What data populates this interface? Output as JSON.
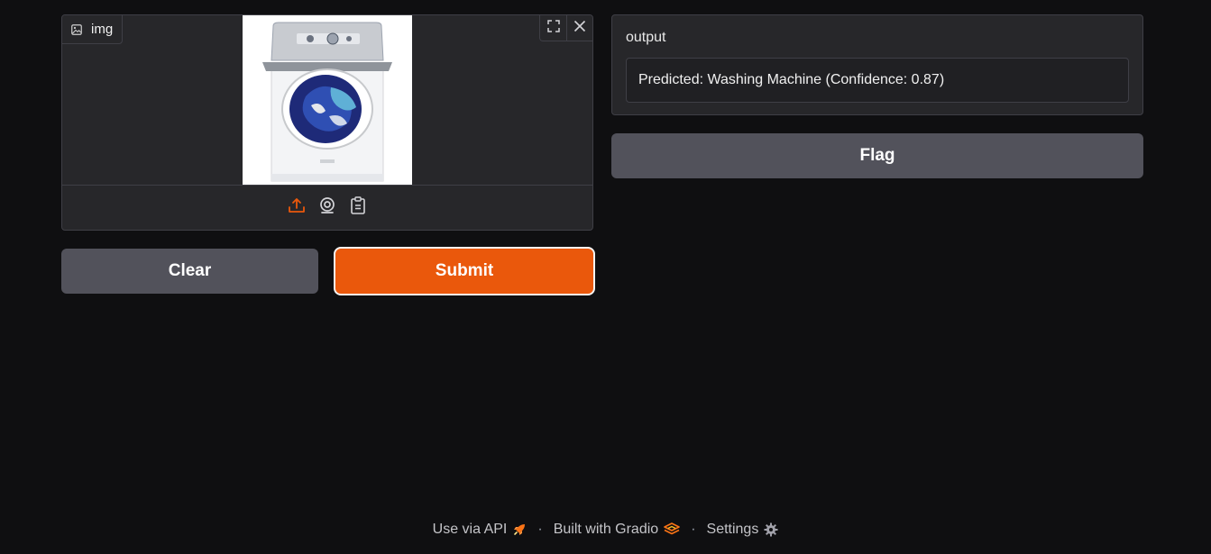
{
  "image_input": {
    "label": "img",
    "label_icon": "image-icon",
    "preview_alt": "Washing machine (top-load) photo"
  },
  "image_controls": {
    "fullscreen_icon": "fullscreen-icon",
    "clear_icon": "close-icon"
  },
  "sources": [
    "upload-icon",
    "webcam-icon",
    "clipboard-icon"
  ],
  "buttons": {
    "clear": "Clear",
    "submit": "Submit",
    "flag": "Flag"
  },
  "output": {
    "label": "output",
    "value": "Predicted: Washing Machine (Confidence: 0.87)"
  },
  "footer": {
    "api": "Use via API",
    "built_with": "Built with Gradio",
    "settings": "Settings",
    "separator": "·"
  },
  "colors": {
    "accent": "#ea580c",
    "background": "#0f0f11",
    "panel": "#27272a",
    "secondary_button": "#52525b"
  }
}
